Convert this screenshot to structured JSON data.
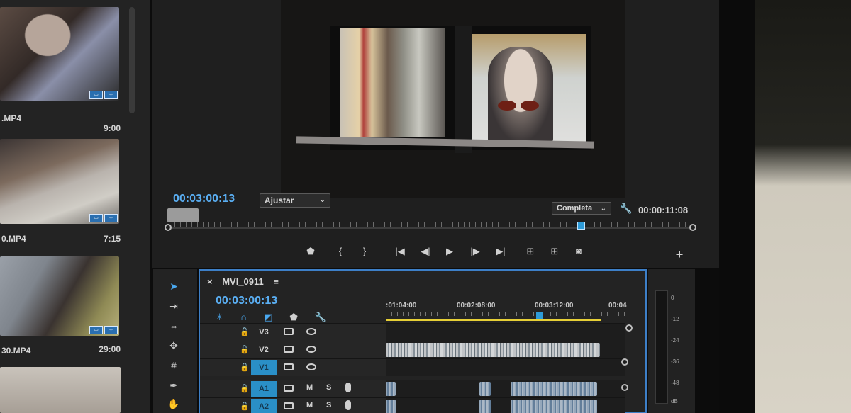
{
  "project": {
    "clips": [
      {
        "name": ".MP4",
        "duration": "9:00",
        "badges": [
          "▭",
          "⇔"
        ]
      },
      {
        "name": "0.MP4",
        "duration": "7:15",
        "badges": [
          "▭",
          "⇔"
        ]
      },
      {
        "name": "30.MP4",
        "duration": "29:00",
        "badges": [
          "▭",
          "⇔"
        ]
      }
    ]
  },
  "program": {
    "current_timecode": "00:03:00:13",
    "zoom_select": "Ajustar",
    "quality_select": "Completa",
    "duration_timecode": "00:00:11:08",
    "playhead_fraction": 0.79
  },
  "transport": {
    "marker_icon": "marker-icon",
    "in_icon": "mark-in-icon",
    "out_icon": "mark-out-icon",
    "go_in_icon": "go-to-in-icon",
    "step_back_icon": "step-back-icon",
    "play_icon": "play-icon",
    "step_fwd_icon": "step-forward-icon",
    "go_out_icon": "go-to-out-icon",
    "lift_icon": "lift-icon",
    "extract_icon": "extract-icon",
    "export_frame_icon": "camera-icon",
    "add_button": "+"
  },
  "timeline": {
    "sequence_name": "MVI_0911",
    "timecode": "00:03:00:13",
    "ruler_labels": [
      ":01:04:00",
      "00:02:08:00",
      "00:03:12:00",
      "00:04"
    ],
    "tracks": [
      {
        "name": "V3",
        "type": "video",
        "targeted": false
      },
      {
        "name": "V2",
        "type": "video",
        "targeted": false
      },
      {
        "name": "V1",
        "type": "video",
        "targeted": true
      },
      {
        "name": "A1",
        "type": "audio",
        "targeted": true,
        "m": "M",
        "s": "S"
      },
      {
        "name": "A2",
        "type": "audio",
        "targeted": true,
        "m": "M",
        "s": "S"
      }
    ]
  },
  "meter": {
    "labels": [
      "0",
      "-12",
      "-24",
      "-36",
      "-48",
      "dB"
    ]
  },
  "colors": {
    "accent": "#5aaef2",
    "panel": "#232323",
    "track_target": "#2a8fc7",
    "border_active": "#3d7fc7"
  }
}
